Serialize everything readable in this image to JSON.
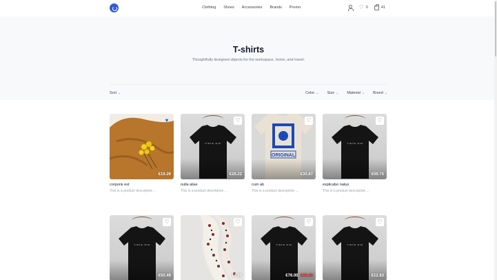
{
  "nav": {
    "menu": [
      "Clothing",
      "Shoes",
      "Accessories",
      "Brands",
      "Promo"
    ],
    "wishlist_count": "0",
    "cart_count": "41"
  },
  "hero": {
    "title": "T-shirts",
    "subtitle": "Thoughtfully designed objects for the workspace, home, and travel."
  },
  "filters": {
    "sort_label": "Sort",
    "items": [
      "Color",
      "Size",
      "Material",
      "Brand"
    ]
  },
  "products": [
    {
      "name": "corporis est",
      "description": "This is a product description ...",
      "price": "€19.26",
      "favorited": true,
      "image": "mustard-scarf-with-yellow-flowers"
    },
    {
      "name": "nulla alias",
      "description": "This is a product description ...",
      "price": "€28.22",
      "favorited": false,
      "image": "black-tshirt"
    },
    {
      "name": "cum ab",
      "description": "This is a product description ...",
      "price": "€30.87",
      "favorited": false,
      "image": "cream-tshirt-blue-print"
    },
    {
      "name": "explicabo natus",
      "description": "This is a product description ...",
      "price": "€59.75",
      "favorited": false,
      "image": "black-tshirt"
    },
    {
      "name": "",
      "description": "",
      "price": "€50.49",
      "favorited": false,
      "image": "black-tshirt"
    },
    {
      "name": "",
      "description": "",
      "price": "€1.39",
      "favorited": false,
      "image": "patterned-scarf"
    },
    {
      "name": "",
      "description": "",
      "price": "€76.00",
      "old_price": "€95.00",
      "favorited": false,
      "image": "black-tshirt"
    },
    {
      "name": "",
      "description": "",
      "price": "€12.83",
      "favorited": false,
      "image": "black-tshirt"
    }
  ],
  "colors": {
    "accent": "#2f5bd6",
    "sale": "#ef4444",
    "hero_bg": "#f8f9fb"
  }
}
